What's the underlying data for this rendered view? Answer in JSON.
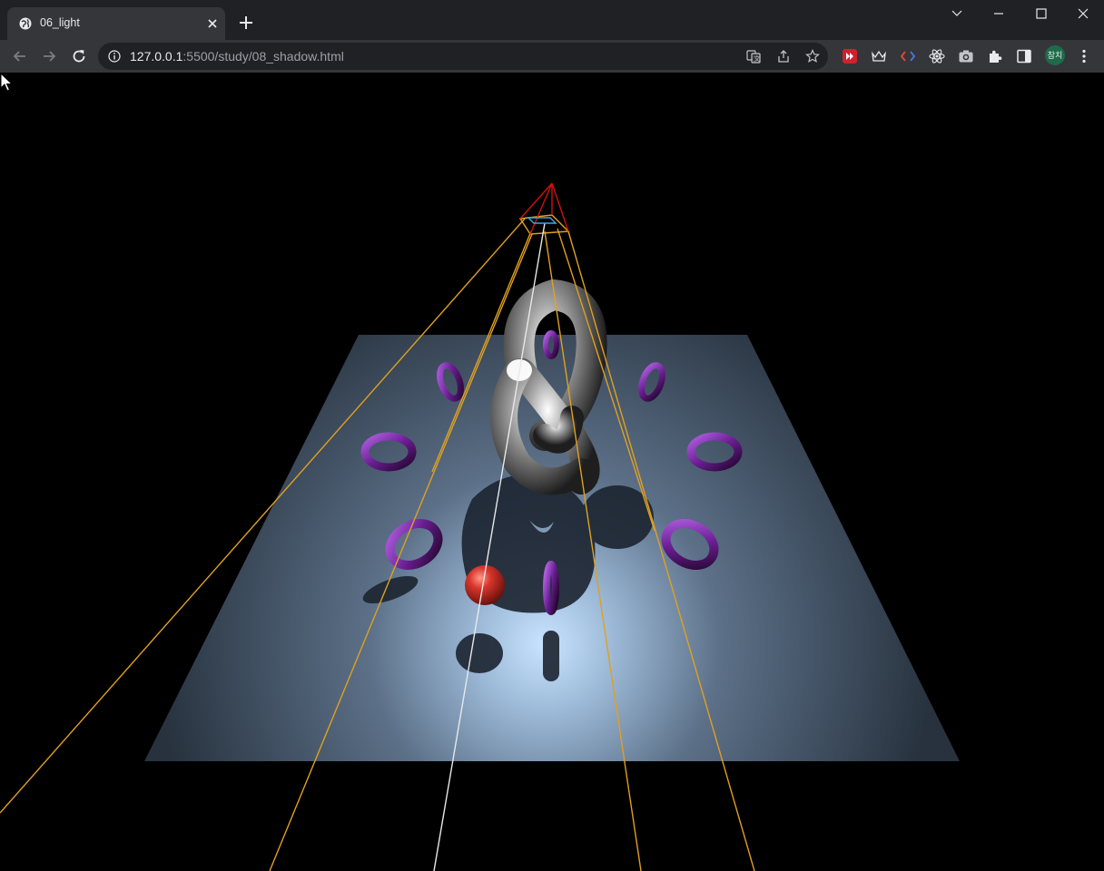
{
  "window": {
    "tab_title": "06_light",
    "controls": [
      "minimize",
      "maximize",
      "close"
    ]
  },
  "toolbar": {
    "url_host": "127.0.0.1",
    "url_rest": ":5500/study/08_shadow.html",
    "icons": [
      "back-icon",
      "forward-icon",
      "reload-icon",
      "info-icon",
      "translate-icon",
      "share-icon",
      "bookmark-star-icon"
    ],
    "extensions": [
      "ext-red-icon",
      "ext-crown-icon",
      "ext-code-icon",
      "react-devtools-icon",
      "camera-icon",
      "puzzle-icon",
      "side-panel-icon"
    ],
    "profile_label": "참치",
    "menu_icon": "more-vert-icon"
  },
  "scene": {
    "description_colors": {
      "plane_base": "#3a4a5a",
      "spot_light": "#c8e4ff",
      "torus": "#7a2aa0",
      "knot": "#8a8a8a",
      "sphere": "#d8362c",
      "helper_cone": "#e0a020",
      "helper_camera": "#d01010"
    }
  }
}
